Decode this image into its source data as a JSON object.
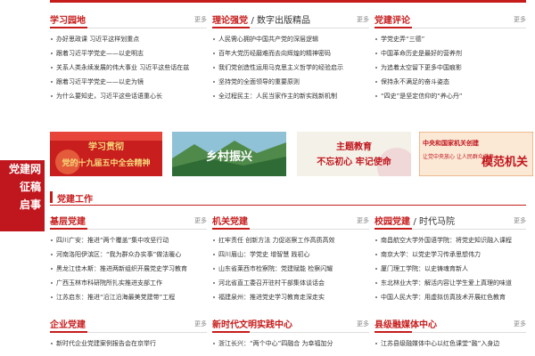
{
  "colors": {
    "accent": "#c61c1c",
    "text": "#333333",
    "muted": "#888888"
  },
  "more_label": "更多",
  "columns_top": [
    {
      "title": "学习园地",
      "sub": "",
      "items": [
        "办好思政课 习近平这样划重点",
        "跟着习近平学党史——以史明志",
        "关系人类永续发展的伟大事业 习近平这些话在兹",
        "跟着习近平学党史——以史为镜",
        "为什么要知史，习近平这些话语重心长"
      ]
    },
    {
      "title": "理论强党",
      "sub": "数字出版精品",
      "items": [
        "人民需心拥护中国共产党的深层逻辑",
        "百年大党历经磨难而去向辉煌的精神密码",
        "我们党创造性运用马克思主义哲学的经验启示",
        "坚持党的全面领导的重要原则",
        "全过程民主：人民当家作主的新实践新机制"
      ]
    },
    {
      "title": "党建评论",
      "sub": "",
      "items": [
        "学党史弄“三德”",
        "中国革命历史是最好的营养剂",
        "为追着太空留下更多中国痕影",
        "保持永不满足的奋斗姿态",
        "“四史”是坚定信仰的“养心丹”"
      ]
    }
  ],
  "banners": [
    {
      "line1": "学习贯彻",
      "line2": "党的十九届五中全会精神"
    },
    {
      "line1": "乡村振兴",
      "line2": ""
    },
    {
      "line1": "主题教育",
      "line2": "不忘初心 牢记使命"
    },
    {
      "line1": "中央和国家机关创建",
      "line2": "让党中央放心 让人民群众满意",
      "big": "模范机关"
    }
  ],
  "sidebar": [
    "党建网",
    "征稿",
    "启事"
  ],
  "section_title": "党建工作",
  "columns_mid": [
    {
      "title": "基层党建",
      "sub": "",
      "items": [
        "四川广安：推进“两个覆盖”集中攻坚行动",
        "河南洛阳伊滨区：“我为群众办实事”做法暖心",
        "黑龙江佳木斯：推进两新组织开展党史学习教育",
        "广西玉林市科研院所扎实推进支部工作",
        "江苏启东：推进“沿江沿海最美党建带”工程"
      ]
    },
    {
      "title": "机关党建",
      "sub": "",
      "items": [
        "扛牢责任 创新方法 力促巡察工作高质高效",
        "四川眉山：学党史 增智慧 践初心",
        "山东省莱西市检察院：党建赋能 检察闪耀",
        "河北省直工委召开驻村干部集体谈话会",
        "福建泉州：推进党史学习教育走深走实"
      ]
    },
    {
      "title": "校园党建",
      "sub": "时代马院",
      "items": [
        "南昌航空大学外国语学院：将党史知识融入课程",
        "南京大学：以党史学习传承思想伟力",
        "厦门理工学院：以史铸魂育新人",
        "东北林业大学：解活内容让学生爱上真理的味道",
        "中国人民大学：用虚拟仿真技术开展红色教育"
      ]
    }
  ],
  "columns_bottom": [
    {
      "title": "企业党建",
      "sub": "",
      "items": [
        "新时代企业党建案例报告会在京举行"
      ]
    },
    {
      "title": "新时代文明实践中心",
      "sub": "",
      "items": [
        "浙江长兴：“两个中心”四融合 为幸福加分"
      ]
    },
    {
      "title": "县级融媒体中心",
      "sub": "",
      "items": [
        "江苏县级融媒体中心以红色课堂“融”入身边"
      ]
    }
  ]
}
